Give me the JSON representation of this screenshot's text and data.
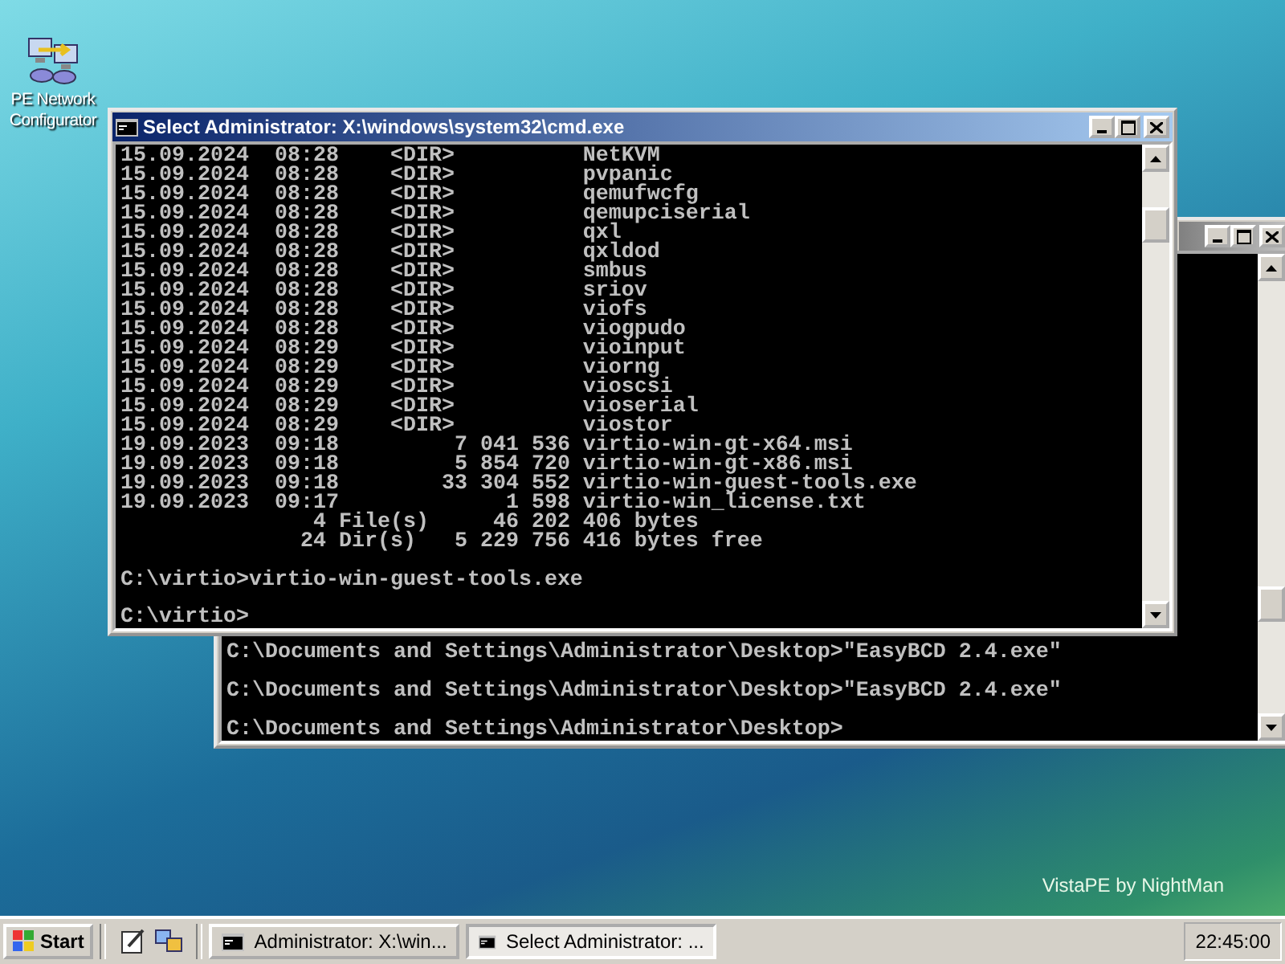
{
  "desktop": {
    "icons": [
      {
        "label": "PE Network Configurator"
      }
    ],
    "wallpaper_text": "VistaPE by NightMan"
  },
  "back_window": {
    "blocks": [
      [
        "C:\\Documents and Settings\\Administrator\\Desktop>\"EasyBCD 2.4.exe\""
      ],
      [
        "C:\\Documents and Settings\\Administrator\\Desktop>\"EasyBCD 2.4.exe\""
      ],
      [
        "C:\\Documents and Settings\\Administrator\\Desktop>"
      ]
    ]
  },
  "front_window": {
    "title": "Select Administrator: X:\\windows\\system32\\cmd.exe",
    "blocks": [
      [
        "15.09.2024  08:28    <DIR>          NetKVM",
        "15.09.2024  08:28    <DIR>          pvpanic",
        "15.09.2024  08:28    <DIR>          qemufwcfg",
        "15.09.2024  08:28    <DIR>          qemupciserial",
        "15.09.2024  08:28    <DIR>          qxl",
        "15.09.2024  08:28    <DIR>          qxldod",
        "15.09.2024  08:28    <DIR>          smbus",
        "15.09.2024  08:28    <DIR>          sriov",
        "15.09.2024  08:28    <DIR>          viofs",
        "15.09.2024  08:28    <DIR>          viogpudo",
        "15.09.2024  08:29    <DIR>          vioinput",
        "15.09.2024  08:29    <DIR>          viorng",
        "15.09.2024  08:29    <DIR>          vioscsi",
        "15.09.2024  08:29    <DIR>          vioserial",
        "15.09.2024  08:29    <DIR>          viostor",
        "19.09.2023  09:18         7 041 536 virtio-win-gt-x64.msi",
        "19.09.2023  09:18         5 854 720 virtio-win-gt-x86.msi",
        "19.09.2023  09:18        33 304 552 virtio-win-guest-tools.exe",
        "19.09.2023  09:17             1 598 virtio-win_license.txt",
        "               4 File(s)     46 202 406 bytes",
        "              24 Dir(s)   5 229 756 416 bytes free"
      ],
      [
        "C:\\virtio>virtio-win-guest-tools.exe"
      ],
      [
        "C:\\virtio>"
      ]
    ]
  },
  "taskbar": {
    "start": "Start",
    "tasks": [
      {
        "label": "Administrator: X:\\win...",
        "selected": false
      },
      {
        "label": "Select Administrator: ...",
        "selected": true
      }
    ],
    "clock": "22:45:00"
  }
}
